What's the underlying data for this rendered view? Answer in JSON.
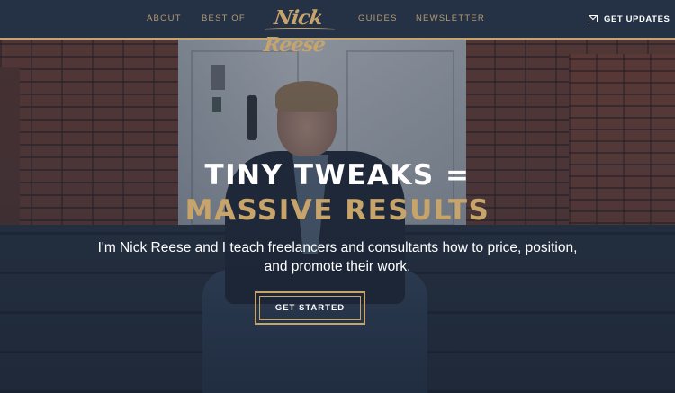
{
  "nav": {
    "about": "ABOUT",
    "best_of": "BEST OF",
    "logo_text": "Nick Reese",
    "guides": "GUIDES",
    "newsletter": "NEWSLETTER",
    "updates": "GET UPDATES",
    "updates_icon": "mail-icon"
  },
  "hero": {
    "headline_line1": "TINY TWEAKS =",
    "headline_line2": "MASSIVE RESULTS",
    "subtitle": "I'm Nick Reese and I teach freelancers and consultants how to price, position, and promote their work.",
    "cta_label": "GET STARTED"
  },
  "colors": {
    "header_bg": "#253246",
    "accent_gold": "#c7a46a",
    "nav_text": "#b59b70",
    "headline_white": "#ffffff"
  }
}
